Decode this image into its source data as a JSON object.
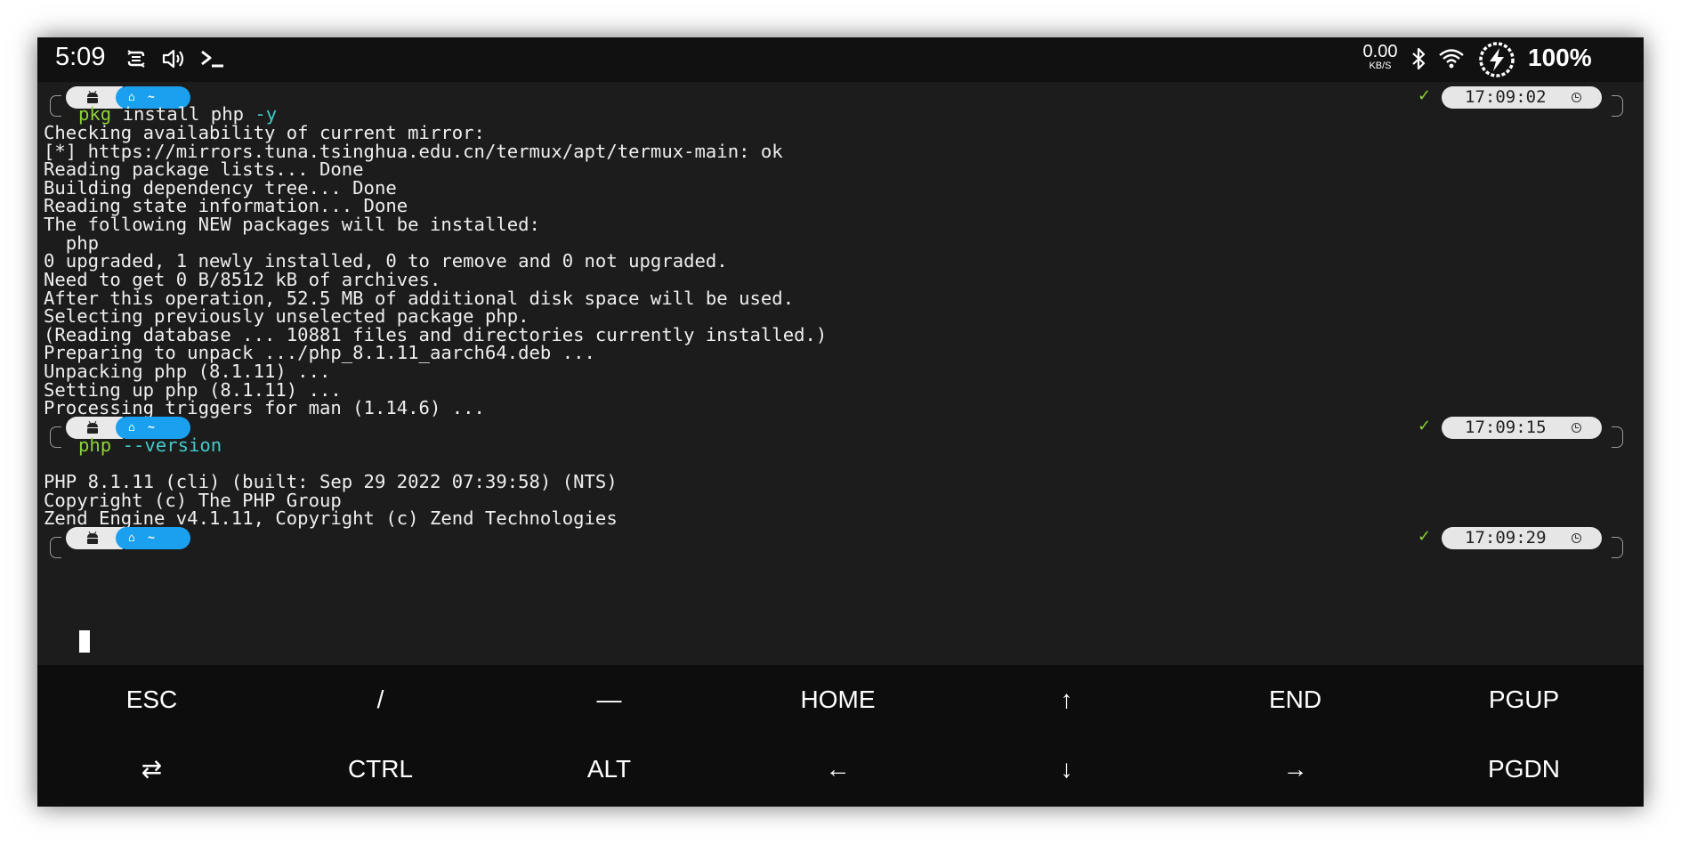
{
  "status_bar": {
    "time": "5:09",
    "net_speed_value": "0.00",
    "net_speed_unit": "KB/S",
    "battery": "100%",
    "icons": [
      "sync-icon",
      "volume-icon",
      "terminal-prompt-icon",
      "bluetooth-icon",
      "wifi-icon",
      "battery-charging-icon"
    ]
  },
  "prompt": {
    "os_icon": "android-icon",
    "dir_icon": "home-icon",
    "dir": "~",
    "ok_mark": "✓"
  },
  "blocks": [
    {
      "cmd": "pkg",
      "args": " install php ",
      "flag": "-y",
      "time": "17:09:02",
      "output": [
        "Checking availability of current mirror:",
        "[*] https://mirrors.tuna.tsinghua.edu.cn/termux/apt/termux-main: ok",
        "Reading package lists... Done",
        "Building dependency tree... Done",
        "Reading state information... Done",
        "The following NEW packages will be installed:",
        "  php",
        "0 upgraded, 1 newly installed, 0 to remove and 0 not upgraded.",
        "Need to get 0 B/8512 kB of archives.",
        "After this operation, 52.5 MB of additional disk space will be used.",
        "Selecting previously unselected package php.",
        "(Reading database ... 10881 files and directories currently installed.)",
        "Preparing to unpack .../php_8.1.11_aarch64.deb ...",
        "Unpacking php (8.1.11) ...",
        "Setting up php (8.1.11) ...",
        "Processing triggers for man (1.14.6) ..."
      ]
    },
    {
      "cmd": "php",
      "args": " ",
      "flag": "--version",
      "time": "17:09:15",
      "output": [
        "",
        "PHP 8.1.11 (cli) (built: Sep 29 2022 07:39:58) (NTS)",
        "Copyright (c) The PHP Group",
        "Zend Engine v4.1.11, Copyright (c) Zend Technologies"
      ]
    },
    {
      "time": "17:09:29"
    }
  ],
  "extra_keys": {
    "row1": [
      "ESC",
      "/",
      "—",
      "HOME",
      "↑",
      "END",
      "PGUP"
    ],
    "row2": [
      "⇄",
      "CTRL",
      "ALT",
      "←",
      "↓",
      "→",
      "PGDN"
    ]
  }
}
